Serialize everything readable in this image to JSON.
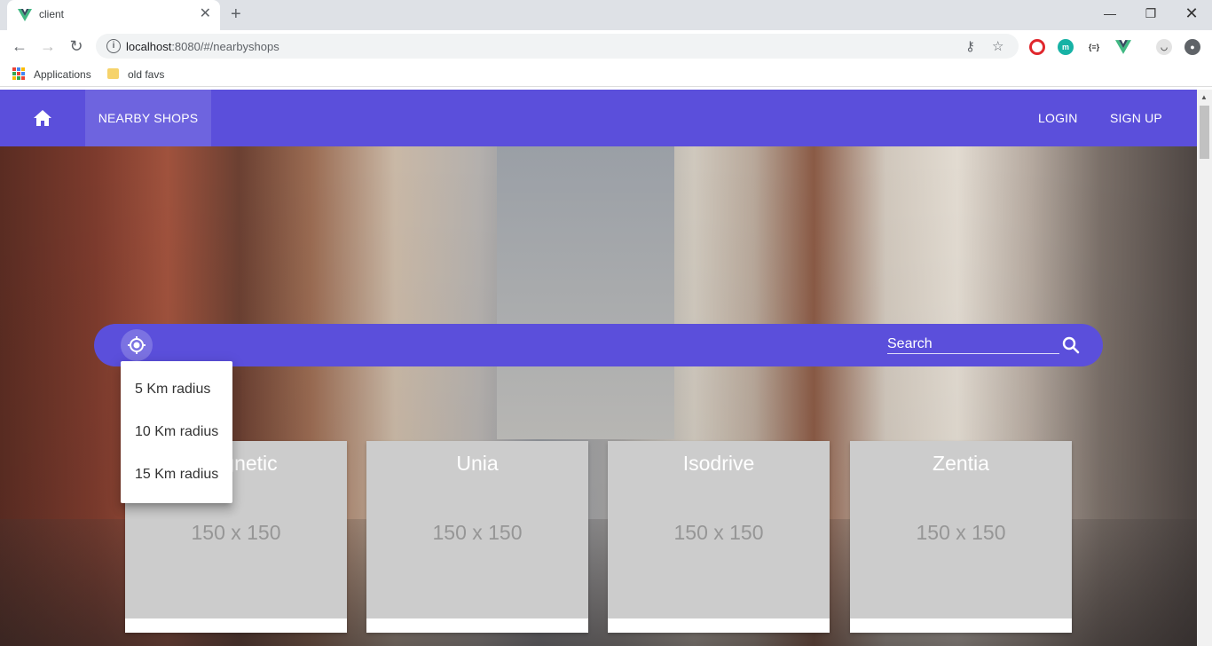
{
  "browser": {
    "tab_title": "client",
    "url_host": "localhost",
    "url_path": ":8080/#/nearbyshops",
    "bookmarks": [
      "Applications",
      "old favs"
    ]
  },
  "nav": {
    "active_label": "NEARBY SHOPS",
    "login_label": "LOGIN",
    "signup_label": "SIGN UP"
  },
  "search": {
    "placeholder": "Search"
  },
  "radius_menu": {
    "items": [
      "5 Km radius",
      "10 Km radius",
      "15 Km radius"
    ]
  },
  "shops": [
    {
      "name": "Magnetic",
      "image_text": "150 x 150"
    },
    {
      "name": "Unia",
      "image_text": "150 x 150"
    },
    {
      "name": "Isodrive",
      "image_text": "150 x 150"
    },
    {
      "name": "Zentia",
      "image_text": "150 x 150"
    }
  ],
  "colors": {
    "primary": "#5b4fdb",
    "placeholder_bg": "#cccccc"
  }
}
